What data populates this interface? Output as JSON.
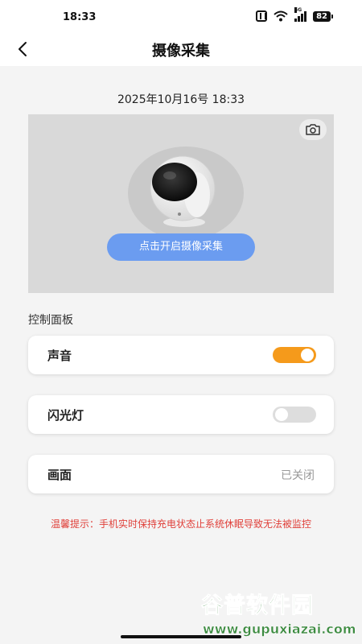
{
  "status_bar": {
    "time": "18:33",
    "network": "5G",
    "battery": "82"
  },
  "header": {
    "title": "摄像采集"
  },
  "capture": {
    "datetime": "2025年10月16号 18:33",
    "start_label": "点击开启摄像采集"
  },
  "control_panel": {
    "title": "控制面板",
    "sound": {
      "label": "声音",
      "enabled": true
    },
    "flash": {
      "label": "闪光灯",
      "enabled": false
    },
    "picture": {
      "label": "画面",
      "status": "已关闭"
    }
  },
  "warning": "温馨提示：手机实时保持充电状态止系统休眠导致无法被监控",
  "watermark": {
    "title": "谷普软件园",
    "url": "www.gupuxiazai.com"
  },
  "colors": {
    "accent_toggle": "#f59a1b",
    "button_blue": "#6b9cf0",
    "warning_red": "#e0403a",
    "watermark_green": "#3b8a3f"
  },
  "icons": [
    "back-arrow-icon",
    "camera-icon",
    "nfc-icon",
    "wifi-icon",
    "signal-icon",
    "battery-icon"
  ]
}
